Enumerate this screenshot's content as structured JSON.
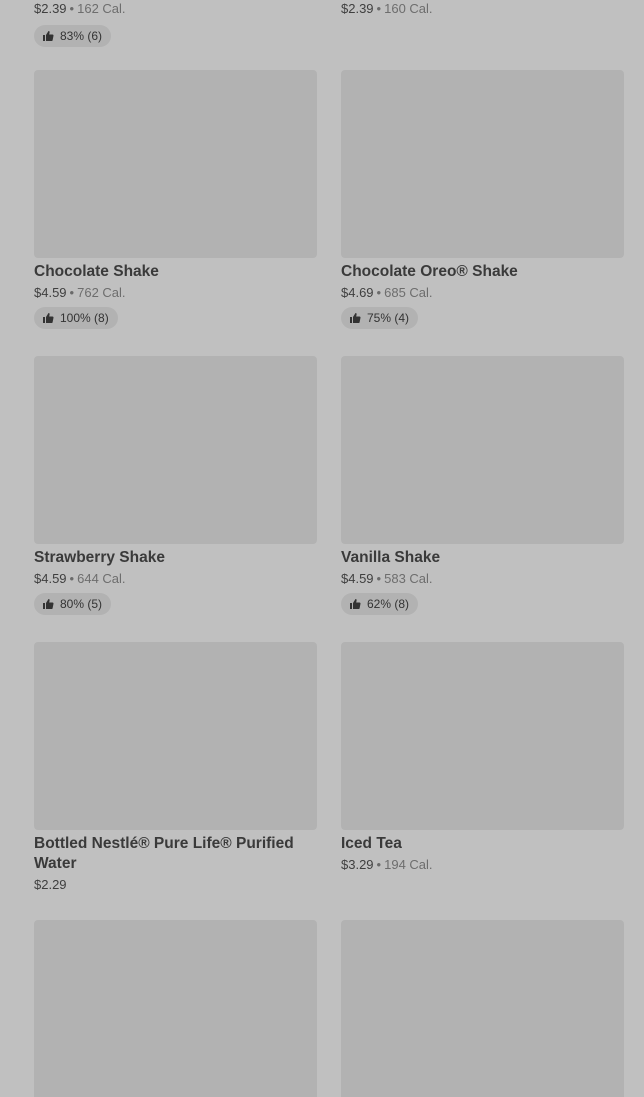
{
  "items": [
    {
      "price": "$2.39",
      "calories": "162 Cal.",
      "rating": "83% (6)"
    },
    {
      "price": "$2.39",
      "calories": "160 Cal."
    },
    {
      "name": "Chocolate Shake",
      "price": "$4.59",
      "calories": "762 Cal.",
      "rating": "100% (8)"
    },
    {
      "name": "Chocolate Oreo® Shake",
      "price": "$4.69",
      "calories": "685 Cal.",
      "rating": "75% (4)"
    },
    {
      "name": "Strawberry Shake",
      "price": "$4.59",
      "calories": "644 Cal.",
      "rating": "80% (5)"
    },
    {
      "name": "Vanilla Shake",
      "price": "$4.59",
      "calories": "583 Cal.",
      "rating": "62% (8)"
    },
    {
      "name": "Bottled Nestlé® Pure Life® Purified Water",
      "price": "$2.29"
    },
    {
      "name": "Iced Tea",
      "price": "$3.29",
      "calories": "194 Cal."
    }
  ],
  "separator": "•",
  "icons": {
    "rating": "thumbs-up-icon"
  }
}
